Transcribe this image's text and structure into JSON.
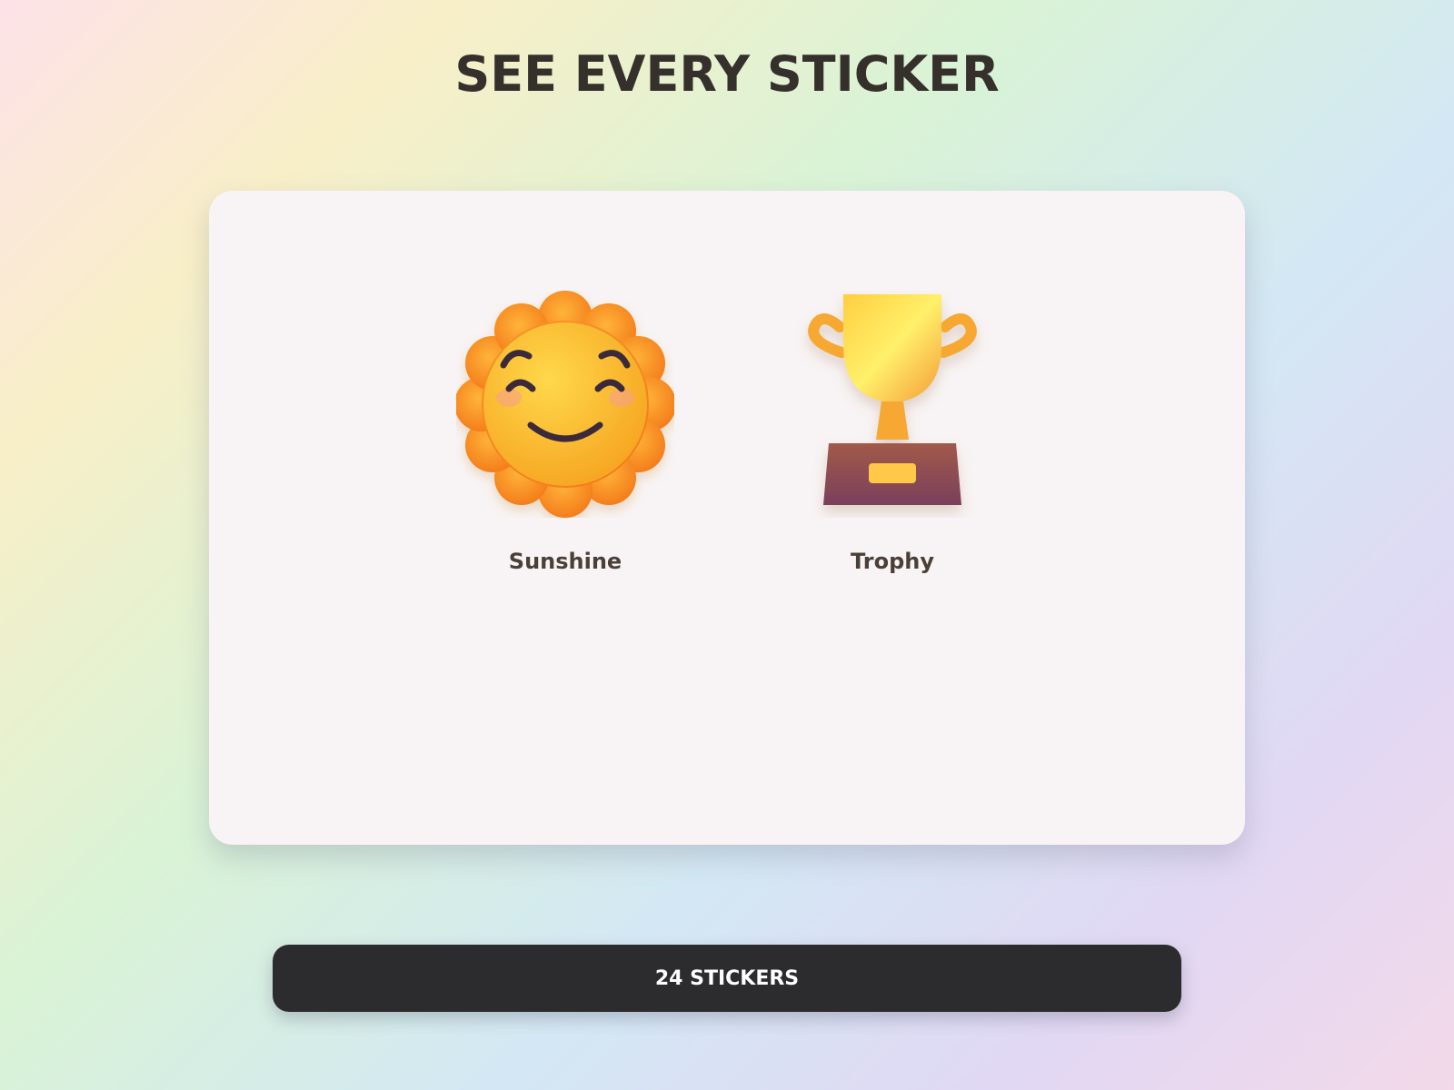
{
  "page": {
    "title": "SEE EVERY STICKER"
  },
  "stickers": [
    {
      "label": "Sunshine",
      "icon": "sunshine-icon"
    },
    {
      "label": "Trophy",
      "icon": "trophy-icon"
    }
  ],
  "footer": {
    "count_label": "24 STICKERS"
  },
  "colors": {
    "title": "#35302b",
    "card": "#f8f4f5",
    "label": "#4b4038",
    "button": "#2c2c2e",
    "button_text": "#ffffff"
  }
}
